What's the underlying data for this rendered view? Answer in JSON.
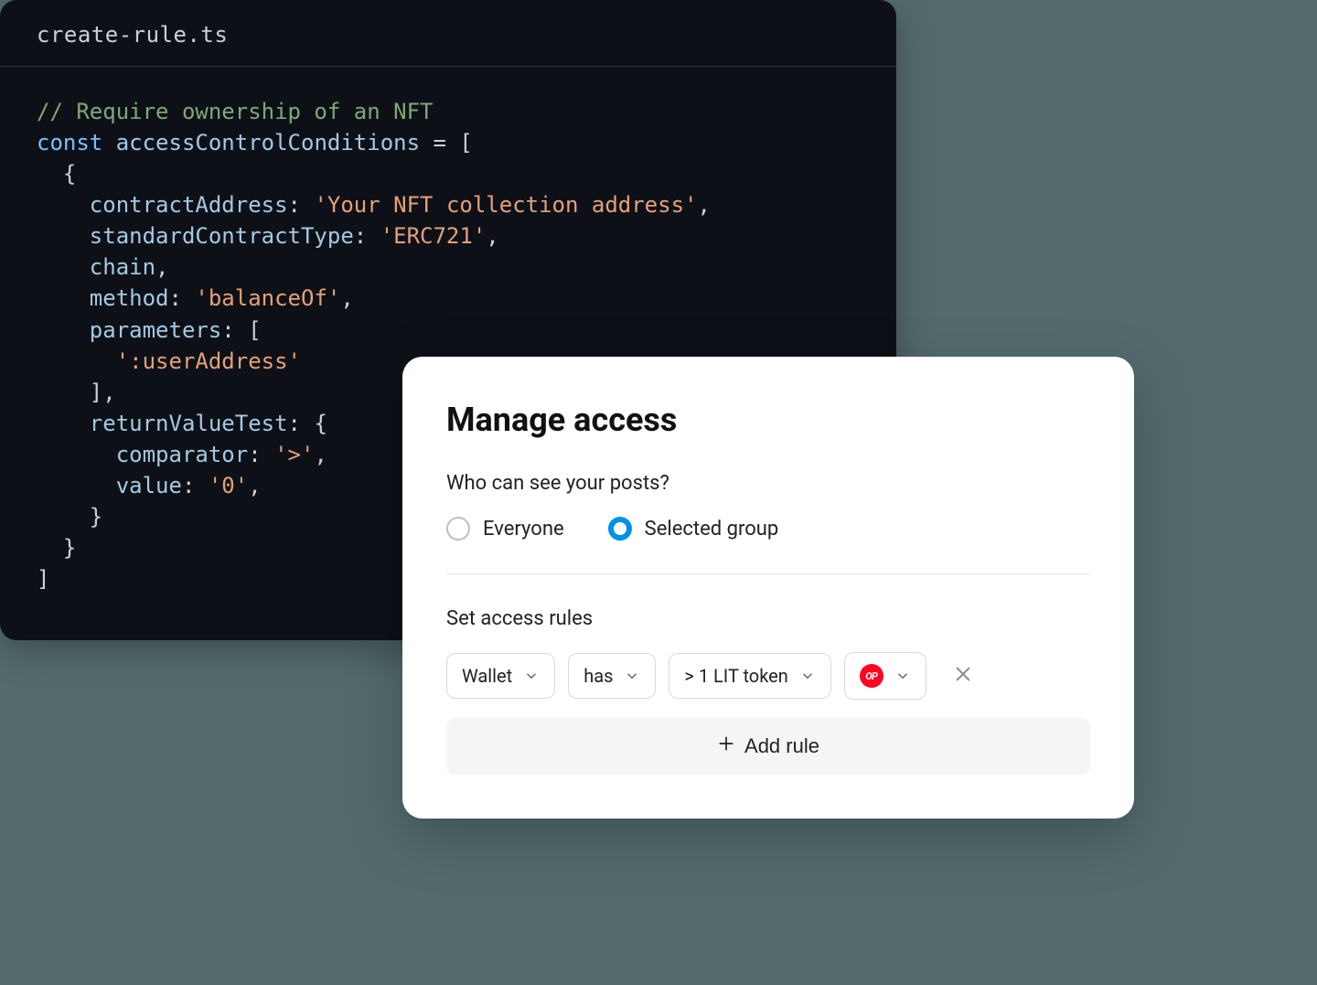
{
  "code": {
    "filename": "create-rule.ts",
    "comment": "// Require ownership of an NFT",
    "kw_const": "const",
    "var_name": "accessControlConditions",
    "prop_contractAddress": "contractAddress",
    "val_contractAddress": "'Your NFT collection address'",
    "prop_standardContractType": "standardContractType",
    "val_standardContractType": "'ERC721'",
    "prop_chain": "chain",
    "prop_method": "method",
    "val_method": "'balanceOf'",
    "prop_parameters": "parameters",
    "val_userAddress": "':userAddress'",
    "prop_returnValueTest": "returnValueTest",
    "prop_comparator": "comparator",
    "val_comparator": "'>'",
    "prop_value": "value",
    "val_value": "'0'"
  },
  "access": {
    "title": "Manage access",
    "question": "Who can see your posts?",
    "option_everyone": "Everyone",
    "option_selected_group": "Selected group",
    "selected_option": "selected_group",
    "rules_title": "Set access rules",
    "rule": {
      "subject": "Wallet",
      "verb": "has",
      "object": "> 1 LIT token",
      "chain_badge": "OP"
    },
    "add_rule_label": "Add rule"
  }
}
